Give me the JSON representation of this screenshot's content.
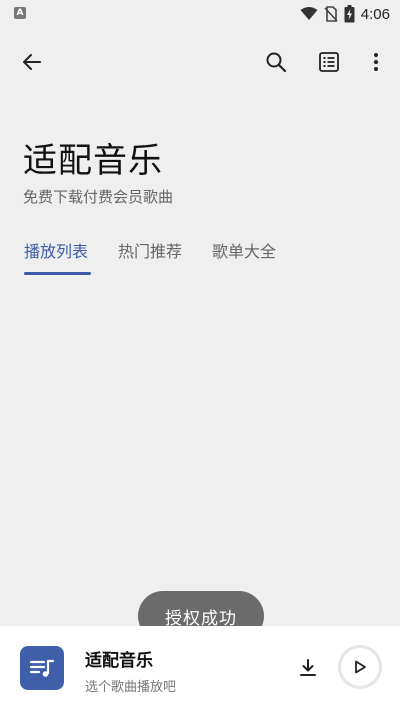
{
  "status_bar": {
    "left_badge": "A",
    "time": "4:06",
    "icons": [
      "wifi-icon",
      "no-sim-icon",
      "battery-charging-icon"
    ]
  },
  "app_bar": {
    "icons": [
      "back-arrow-icon",
      "search-icon",
      "list-icon",
      "more-vert-icon"
    ]
  },
  "header": {
    "title": "适配音乐",
    "subtitle": "免费下载付费会员歌曲"
  },
  "tabs": [
    {
      "label": "播放列表",
      "active": true
    },
    {
      "label": "热门推荐",
      "active": false
    },
    {
      "label": "歌单大全",
      "active": false
    }
  ],
  "toast": {
    "text": "授权成功"
  },
  "player": {
    "title": "适配音乐",
    "subtitle": "选个歌曲播放吧",
    "icons": [
      "playlist-music-icon",
      "download-icon",
      "play-icon"
    ]
  },
  "colors": {
    "accent": "#3d5ba8",
    "background": "#efefef",
    "toast_bg": "#6b6b6b",
    "cover_bg": "#3f5fab"
  }
}
